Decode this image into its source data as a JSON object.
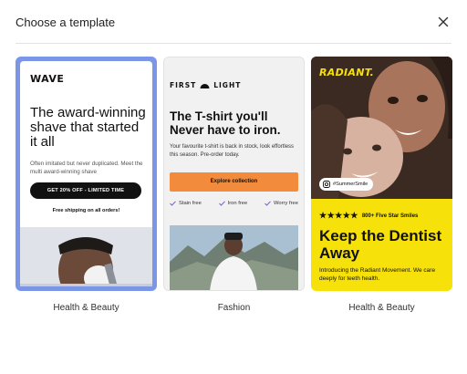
{
  "modal": {
    "title": "Choose a template"
  },
  "templates": [
    {
      "category": "Health & Beauty",
      "brand": "WAVE",
      "headline": "The award-winning shave that started it all",
      "subtext": "Often imitated but never duplicated. Meet the multi award-winning shave",
      "cta": "GET 20% OFF - LIMITED TIME",
      "note": "Free shipping on all orders!",
      "accent_color": "#7b96e6"
    },
    {
      "category": "Fashion",
      "brand_left": "FIRST",
      "brand_right": "LIGHT",
      "headline": "The T-shirt you'll Never have to iron.",
      "subtext": "Your favourite t-shirt is back in stock, look effortless this season. Pre-order today.",
      "cta": "Explore collection",
      "features": [
        "Stain free",
        "Iron free",
        "Worry free"
      ],
      "accent_color": "#f28b3c"
    },
    {
      "category": "Health & Beauty",
      "brand": "RADIANT.",
      "tag": "#SummerSmile",
      "rating": "800+ Five Star Smiles",
      "stars": "★★★★★",
      "headline": "Keep the Dentist Away",
      "subtext": "Introducing the Radiant Movement. We care deeply for teeth health.",
      "accent_color": "#f6e10a"
    }
  ]
}
